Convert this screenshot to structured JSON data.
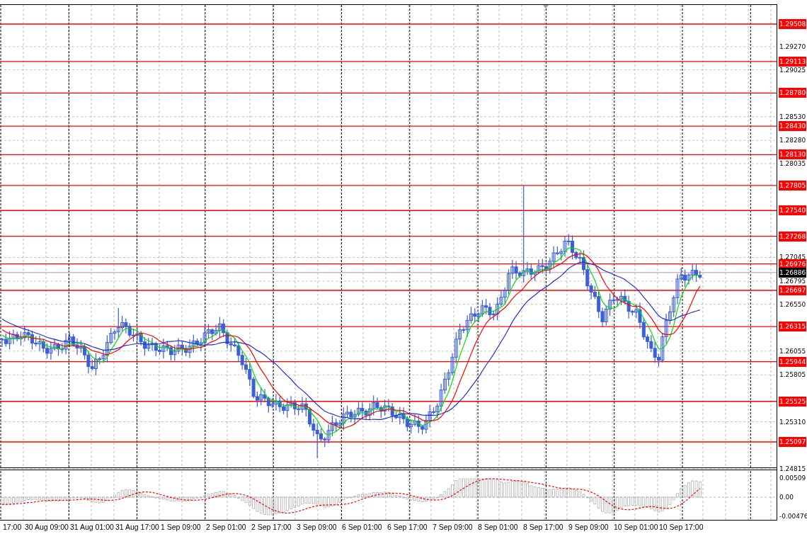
{
  "price_axis": {
    "ticks": [
      "1.29270",
      "1.29025",
      "1.28530",
      "1.28280",
      "1.28035",
      "1.27045",
      "1.26795",
      "1.26550",
      "1.26055",
      "1.25805",
      "1.25310",
      "1.24815"
    ],
    "levels": [
      "1.29508",
      "1.29113",
      "1.28780",
      "1.28430",
      "1.28130",
      "1.27805",
      "1.27540",
      "1.27268",
      "1.26976",
      "1.26697",
      "1.26315",
      "1.25944",
      "1.25525",
      "1.25097"
    ],
    "current_price": "1.26886"
  },
  "indicator_axis": {
    "ticks": [
      "0.00509",
      "0.00",
      "-0.00476"
    ]
  },
  "time_axis": {
    "labels": [
      "17:00",
      "30 Aug 09:00",
      "31 Aug 01:00",
      "31 Aug 17:00",
      "1 Sep 09:00",
      "2 Sep 01:00",
      "2 Sep 17:00",
      "3 Sep 09:00",
      "6 Sep 01:00",
      "6 Sep 17:00",
      "7 Sep 09:00",
      "8 Sep 01:00",
      "8 Sep 17:00",
      "9 Sep 09:00",
      "10 Sep 01:00",
      "10 Sep 17:00"
    ]
  }
}
